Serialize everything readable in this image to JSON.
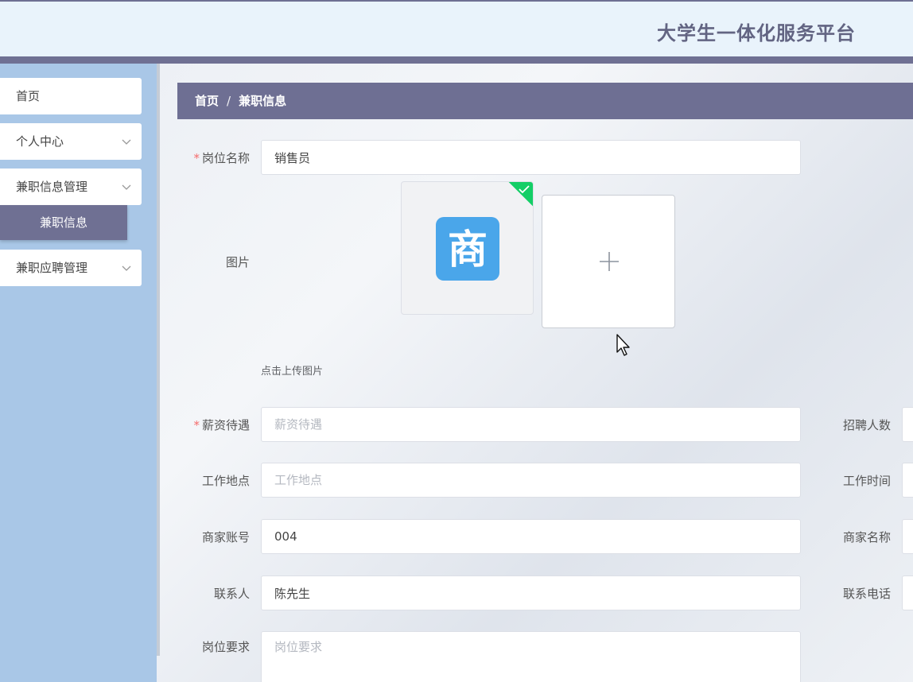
{
  "header": {
    "title": "大学生一体化服务平台"
  },
  "sidebar": {
    "items": [
      {
        "label": "首页"
      },
      {
        "label": "个人中心"
      },
      {
        "label": "兼职信息管理"
      },
      {
        "label": "兼职应聘管理"
      }
    ],
    "active_sub": "兼职信息"
  },
  "breadcrumb": {
    "home": "首页",
    "separator": "/",
    "current": "兼职信息"
  },
  "form": {
    "position_name": {
      "label": "岗位名称",
      "value": "销售员"
    },
    "image": {
      "label": "图片",
      "thumb_glyph": "商",
      "add_glyph": "+",
      "tip": "点击上传图片"
    },
    "salary": {
      "label": "薪资待遇",
      "placeholder": "薪资待遇"
    },
    "location": {
      "label": "工作地点",
      "placeholder": "工作地点"
    },
    "merchant_account": {
      "label": "商家账号",
      "value": "004"
    },
    "contact": {
      "label": "联系人",
      "value": "陈先生"
    },
    "requirements": {
      "label": "岗位要求",
      "placeholder": "岗位要求"
    },
    "recruit_count": {
      "label": "招聘人数"
    },
    "work_time": {
      "label": "工作时间"
    },
    "merchant_name": {
      "label": "商家名称"
    },
    "contact_phone": {
      "label": "联系电话"
    },
    "required_mark": "*"
  },
  "colors": {
    "accent": "#6e6f93",
    "sidebar": "#a9c7e7",
    "success": "#13ce66",
    "logo": "#4aa6ea"
  }
}
